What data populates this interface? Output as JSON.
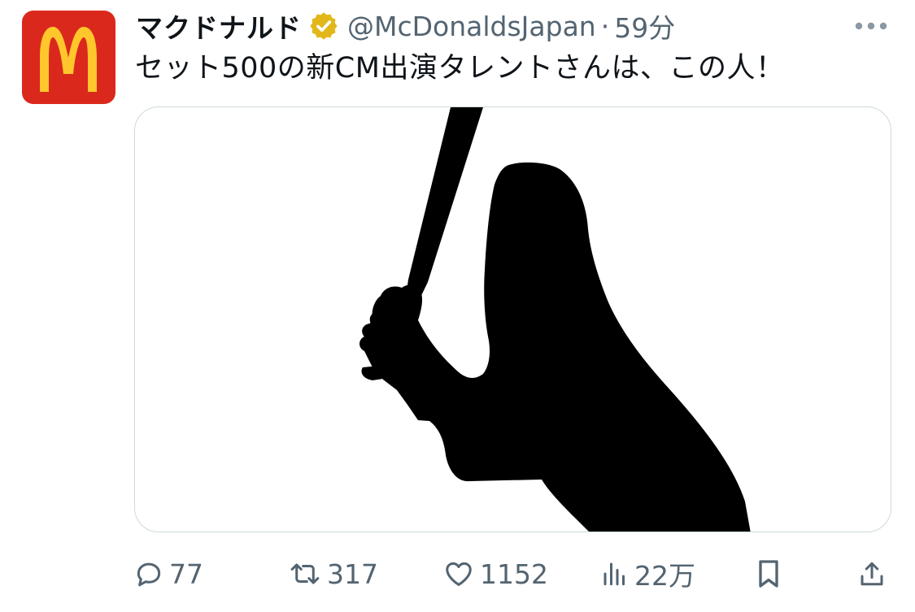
{
  "account": {
    "display_name": "マクドナルド",
    "handle": "@McDonaldsJapan",
    "separator": "·",
    "time": "59分",
    "verified_color": "#e2b719",
    "avatar_bg": "#da291c",
    "avatar_logo_color": "#ffc72c",
    "avatar_icon": "mcdonalds-logo"
  },
  "tweet": {
    "text": "セット500の新CM出演タレントさんは、この人！",
    "media_description": "baseball-batter-silhouette"
  },
  "actions": {
    "reply_count": "77",
    "retweet_count": "317",
    "like_count": "1152",
    "view_count": "22万"
  },
  "colors": {
    "text_primary": "#0f1419",
    "text_secondary": "#536471",
    "border": "#cfd9de"
  }
}
